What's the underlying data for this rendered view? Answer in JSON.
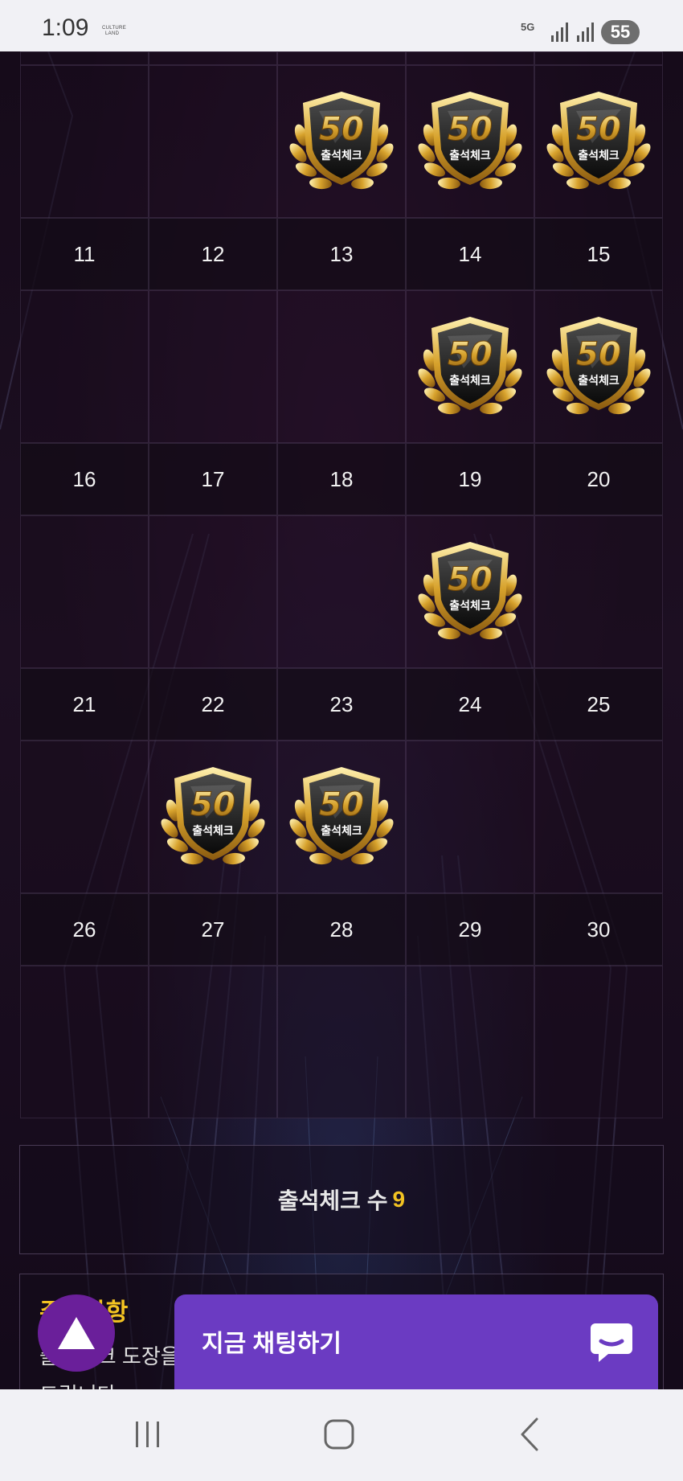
{
  "status_bar": {
    "time": "1:09",
    "brand_line1": "CULTURE",
    "brand_line2": "LAND",
    "network": "5G",
    "battery": "55"
  },
  "calendar": {
    "rows": [
      {
        "dates": [
          "11",
          "12",
          "13",
          "14",
          "15"
        ],
        "stamps": [
          false,
          false,
          true,
          true,
          true
        ]
      },
      {
        "dates": [
          "16",
          "17",
          "18",
          "19",
          "20"
        ],
        "stamps": [
          false,
          false,
          false,
          true,
          true
        ]
      },
      {
        "dates": [
          "21",
          "22",
          "23",
          "24",
          "25"
        ],
        "stamps": [
          false,
          false,
          false,
          true,
          false
        ]
      },
      {
        "dates": [
          "26",
          "27",
          "28",
          "29",
          "30"
        ],
        "stamps": [
          false,
          true,
          true,
          false,
          false
        ]
      }
    ],
    "badge_number": "50",
    "badge_text": "출석체크"
  },
  "summary": {
    "label": "출석체크 수",
    "count": "9"
  },
  "notice": {
    "title": "주의사항",
    "line1": "출석체크 도장을",
    "line2": "드립니다"
  },
  "chat": {
    "label": "지금 채팅하기"
  },
  "colors": {
    "accent_gold": "#f3c322",
    "chat_purple": "#6b3bc2",
    "fab_purple": "#6a1f9a"
  }
}
